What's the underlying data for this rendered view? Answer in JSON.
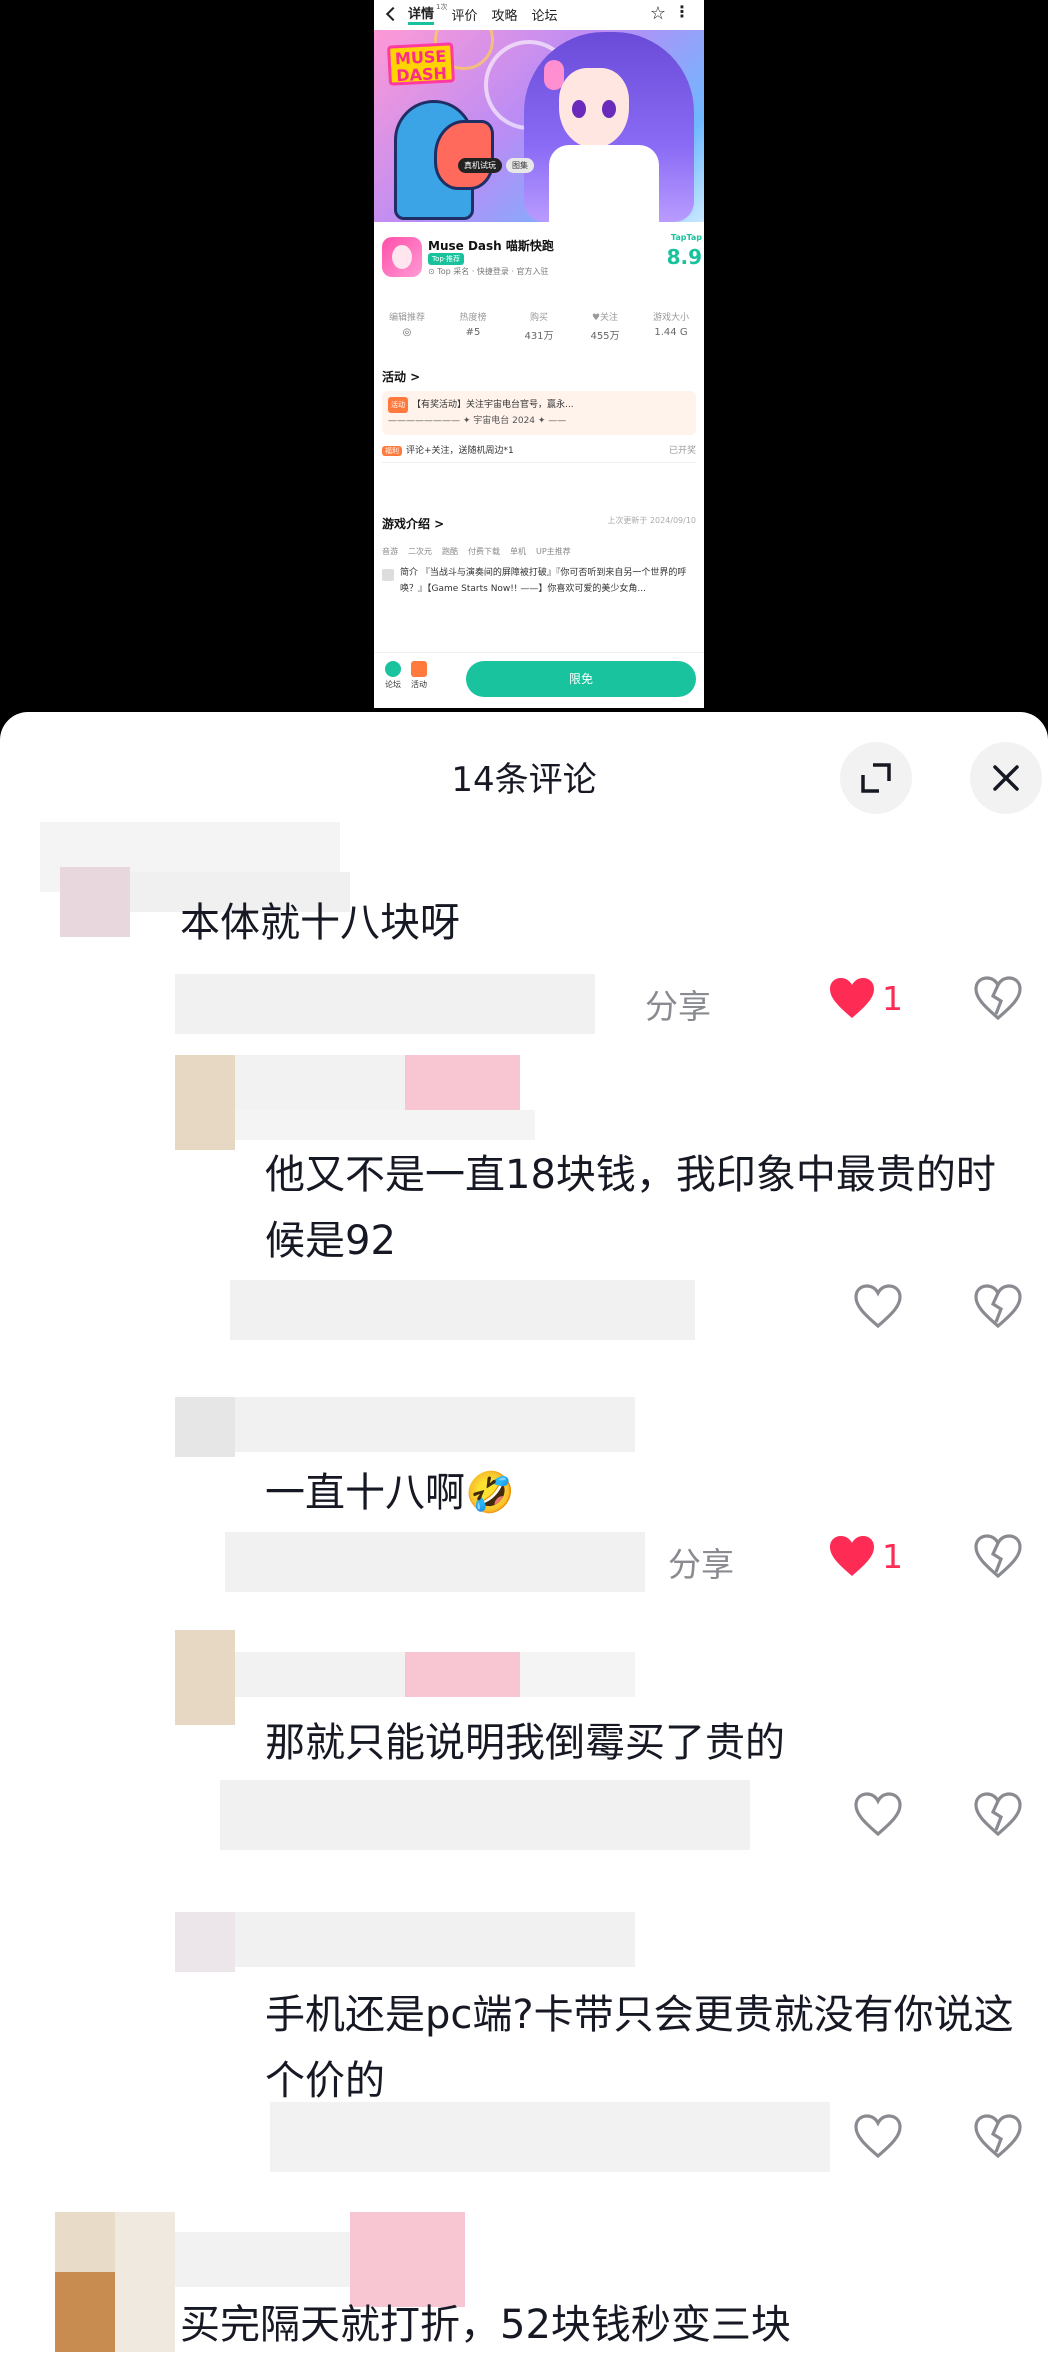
{
  "app_screenshot": {
    "tabs": [
      "详情",
      "评价",
      "攻略",
      "论坛"
    ],
    "tab_sup": "1次",
    "banner_chips": [
      "真机试玩",
      "图集"
    ],
    "logo_text": [
      "MUSE",
      "DASH"
    ],
    "app_name": "Muse Dash 喵斯快跑",
    "app_tag": "Top·推荐",
    "app_sub": "⊙ Top 采名 · 快捷登录 · 官方入驻",
    "score_label": "TapTap",
    "score": "8.9",
    "stats": [
      {
        "label": "编辑推荐",
        "value": "◎"
      },
      {
        "label": "热度榜",
        "value": "#5"
      },
      {
        "label": "购买",
        "value": "431万"
      },
      {
        "label": "♥关注",
        "value": "455万"
      },
      {
        "label": "游戏大小",
        "value": "1.44 G"
      }
    ],
    "activity_title": "活动 >",
    "activity_tag": "活动",
    "activity_line1": "【有奖活动】关注宇宙电台官号，赢永...",
    "activity_line2": "———————— ✦ 宇宙电台 2024 ✦ ——",
    "activity2_tag": "福利",
    "activity2_text": "评论+关注，送随机周边*1",
    "activity2_status": "已开奖",
    "intro_title": "游戏介绍 >",
    "intro_date": "上次更新于 2024/09/10",
    "intro_tags": [
      "音游",
      "二次元",
      "跑酷",
      "付费下载",
      "单机",
      "UP主推荐"
    ],
    "intro_desc": "简介 『当战斗与演奏间的屏障被打破』『你可否听到来自另一个世界的呼唤？』【Game Starts Now!! ——】你喜欢可爱的美少女角...",
    "bottom_items": [
      "论坛",
      "活动"
    ],
    "bottom_button": "限免"
  },
  "sheet": {
    "title": "14条评论"
  },
  "comments": [
    {
      "text": "本体就十八块呀",
      "share": "分享",
      "likes": "1",
      "liked": true
    },
    {
      "text": "他又不是一直18块钱，我印象中最贵的时候是92",
      "liked": false
    },
    {
      "text": "一直十八啊🤣",
      "share": "分享",
      "likes": "1",
      "liked": true
    },
    {
      "text": "那就只能说明我倒霉买了贵的",
      "liked": false
    },
    {
      "text": "手机还是pc端?卡带只会更贵就没有你说这个价的",
      "liked": false
    },
    {
      "text": "买完隔天就打折，52块钱秒变三块"
    }
  ],
  "colors": {
    "accent_green": "#19c39d",
    "like_red": "#fe2c55",
    "text_main": "#161823",
    "text_secondary": "#8a8b91"
  },
  "icons": [
    "expand-icon",
    "close-icon",
    "heart-filled-icon",
    "heart-outline-icon",
    "heart-broken-icon"
  ]
}
